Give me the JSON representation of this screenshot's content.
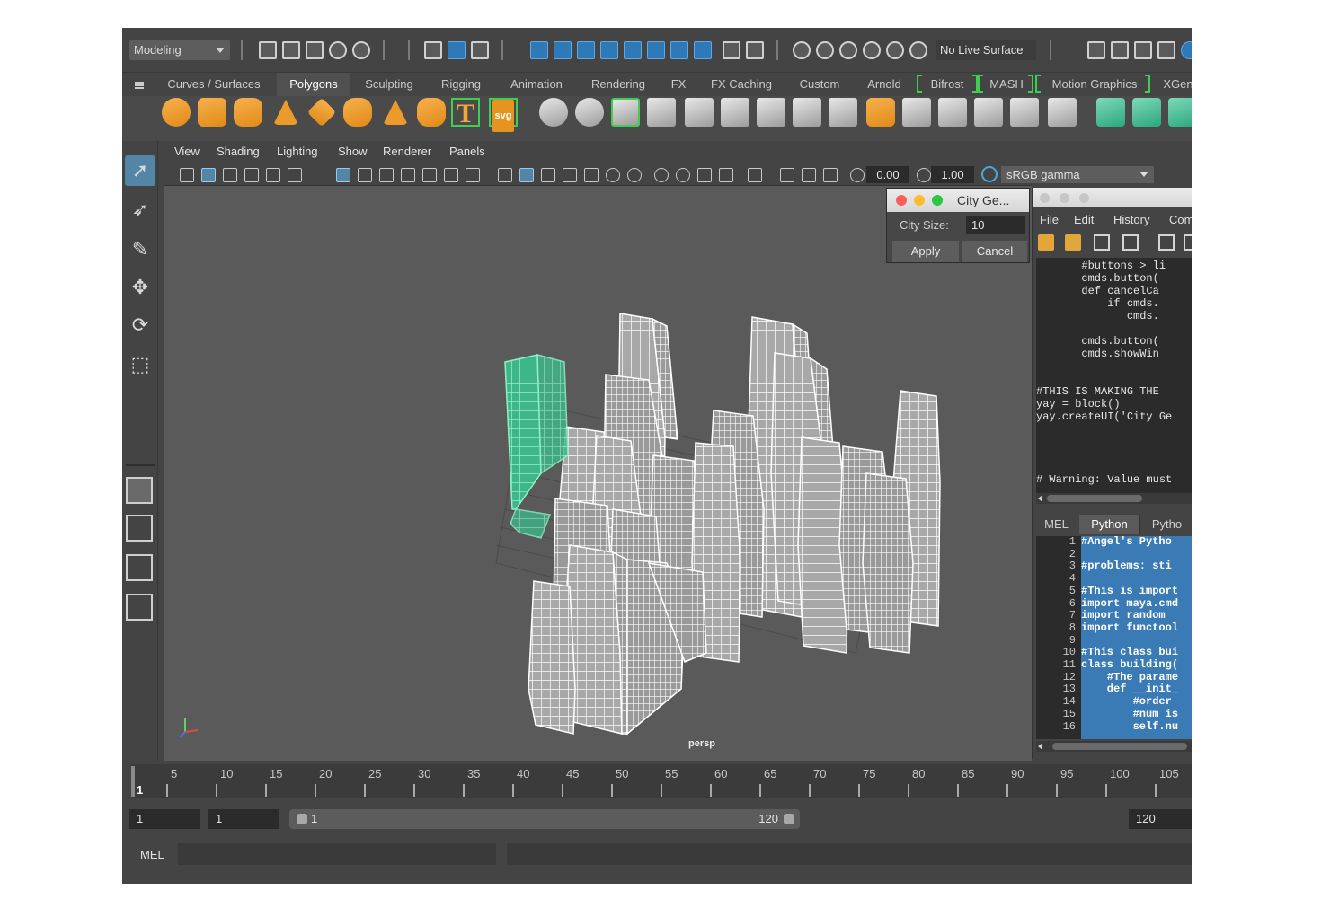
{
  "status_line": {
    "mode": "Modeling",
    "live_surface": "No Live Surface"
  },
  "shelf": {
    "tabs": [
      "Curves / Surfaces",
      "Polygons",
      "Sculpting",
      "Rigging",
      "Animation",
      "Rendering",
      "FX",
      "FX Caching",
      "Custom",
      "Arnold",
      "Bifrost",
      "MASH",
      "Motion Graphics",
      "XGen"
    ],
    "active_tab": "Polygons",
    "text_icon": "T",
    "svg_icon": "svg"
  },
  "viewport": {
    "menu": [
      "View",
      "Shading",
      "Lighting",
      "Show",
      "Renderer",
      "Panels"
    ],
    "exposure": "0.00",
    "gamma": "1.00",
    "color_space": "sRGB gamma",
    "camera_label": "persp"
  },
  "city_dialog": {
    "title": "City Ge...",
    "size_label": "City Size:",
    "size_value": "10",
    "apply_label": "Apply",
    "cancel_label": "Cancel"
  },
  "script_editor": {
    "menu": [
      "File",
      "Edit",
      "History",
      "Com"
    ],
    "history_text": "       #buttons > li\n       cmds.button(\n       def cancelCa\n           if cmds.\n              cmds.\n\n       cmds.button(\n       cmds.showWin\n\n\n#THIS IS MAKING THE \nyay = block()\nyay.createUI('City Ge\n\n\n\n\n# Warning: Value must",
    "tabs": [
      "MEL",
      "Python",
      "Pytho"
    ],
    "line_numbers": "1\n2\n3\n4\n5\n6\n7\n8\n9\n10\n11\n12\n13\n14\n15\n16",
    "code_text": "#Angel's Pytho\n\n#problems: sti\n\n#This is import\nimport maya.cmd\nimport random\nimport functool\n\n#This class bui\nclass building(\n    #The parame\n    def __init_\n        #order\n        #num is\n        self.nu"
  },
  "timeline": {
    "start_frame": "1",
    "tick_labels": [
      "5",
      "10",
      "15",
      "20",
      "25",
      "30",
      "35",
      "40",
      "45",
      "50",
      "55",
      "60",
      "65",
      "70",
      "75",
      "80",
      "85",
      "90",
      "95",
      "100",
      "105"
    ],
    "current_frame": "1",
    "range_start": "1",
    "range_start_inner": "1",
    "range_end_inner": "120",
    "range_end": "120"
  },
  "command_line": {
    "language": "MEL"
  },
  "colors": {
    "accent_blue": "#5285a6",
    "shelf_orange": "#ec9a2b",
    "selection_green": "#5fe0a8",
    "wire_white": "#ffffff"
  }
}
